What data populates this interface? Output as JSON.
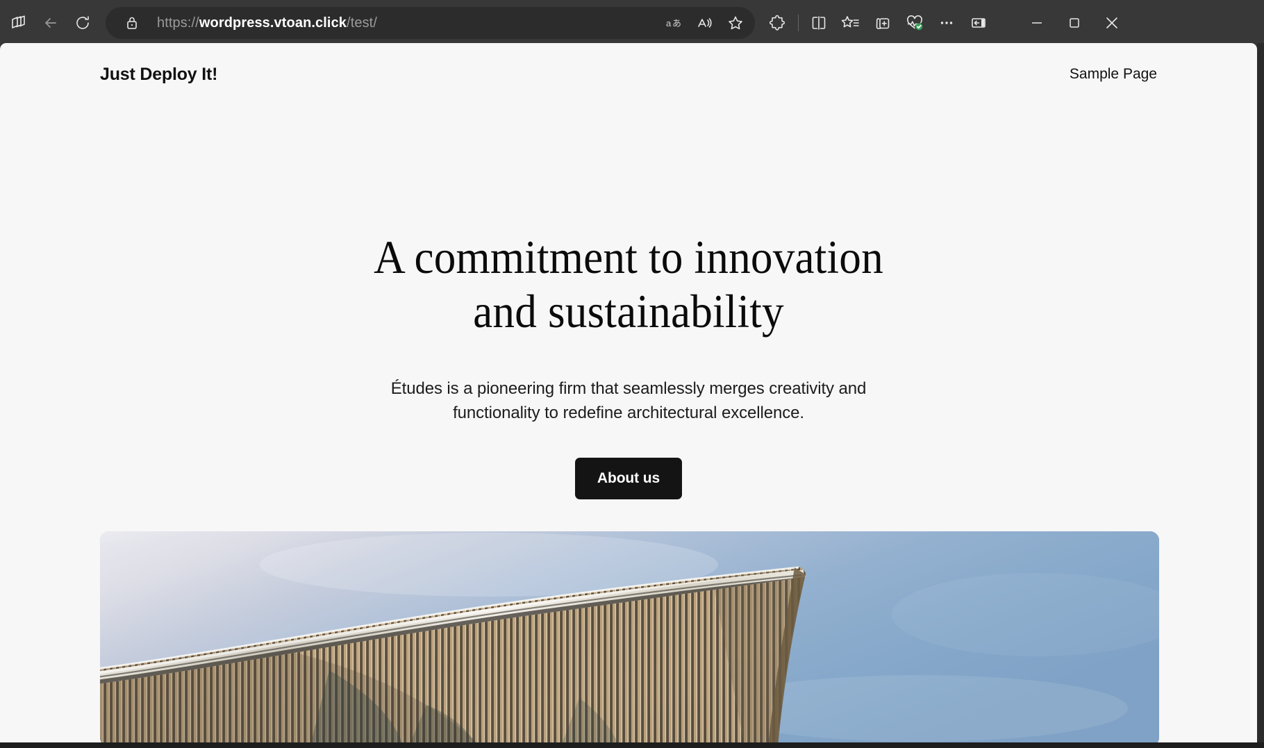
{
  "browser": {
    "url_scheme": "https://",
    "url_host": "wordpress.vtoan.click",
    "url_path": "/test/",
    "url_full": "https://wordpress.vtoan.click/test/",
    "toolbar_left_icons": [
      "copilot-icon",
      "back-arrow-icon",
      "reload-icon"
    ],
    "address_icons": [
      "lock-icon",
      "translate-icon",
      "read-aloud-icon",
      "favorite-star-icon"
    ],
    "toolbar_right_icons": [
      "extensions-puzzle-icon",
      "split-screen-icon",
      "favorites-list-icon",
      "collections-icon",
      "browser-essentials-icon",
      "more-options-icon",
      "sidebar-toggle-icon"
    ],
    "window_controls": [
      "minimize-icon",
      "maximize-icon",
      "close-icon"
    ],
    "chrome_bg": "#383838",
    "addressbar_bg": "#2c2c2c"
  },
  "site": {
    "title": "Just Deploy It!",
    "nav": [
      {
        "label": "Sample Page"
      }
    ]
  },
  "hero": {
    "heading": "A commitment to innovation and sustainability",
    "subtext": "Études is a pioneering firm that seamlessly merges creativity and functionality to redefine architectural excellence.",
    "cta_label": "About us",
    "cta_bg": "#141414",
    "cta_text_color": "#ffffff",
    "image_alt": "architecture-photo",
    "image_description": "Upward view of a modern building with vertical bronze louver fins and a curved roof edge against a blue sky"
  },
  "page": {
    "background": "#f7f7f7",
    "text_color": "#111111"
  }
}
